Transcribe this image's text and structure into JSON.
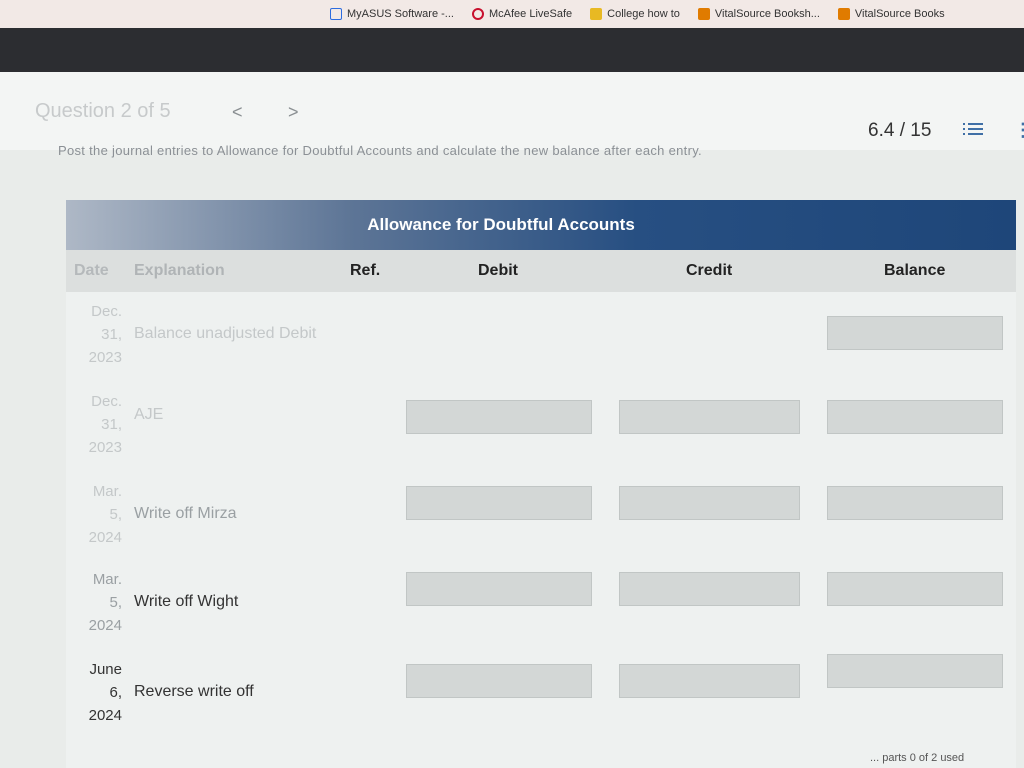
{
  "bookmarks": [
    {
      "label": "MyASUS Software -...",
      "color": "#2d6cdf"
    },
    {
      "label": "McAfee LiveSafe",
      "color": "#c8102e"
    },
    {
      "label": "College how to",
      "color": "#e8b923"
    },
    {
      "label": "VitalSource Booksh...",
      "color": "#e07b00"
    },
    {
      "label": "VitalSource Books",
      "color": "#e07b00"
    }
  ],
  "question": {
    "label": "Question 2 of 5",
    "prev": "<",
    "next": ">",
    "score": "6.4 / 15",
    "instruction": "Post the journal entries to Allowance for Doubtful Accounts and calculate the new balance after each entry."
  },
  "ledger": {
    "title": "Allowance for Doubtful Accounts",
    "columns": {
      "date": "Date",
      "explanation": "Explanation",
      "ref": "Ref.",
      "debit": "Debit",
      "credit": "Credit",
      "balance": "Balance"
    },
    "rows": [
      {
        "date_line1": "Dec.",
        "date_line2": "31,",
        "date_line3": "2023",
        "explanation": "Balance unadjusted Debit"
      },
      {
        "date_line1": "Dec.",
        "date_line2": "31,",
        "date_line3": "2023",
        "explanation": "AJE"
      },
      {
        "date_line1": "Mar.",
        "date_line2": "5,",
        "date_line3": "2024",
        "explanation": "Write off Mirza"
      },
      {
        "date_line1": "Mar.",
        "date_line2": "5,",
        "date_line3": "2024",
        "explanation": "Write off Wight"
      },
      {
        "date_line1": "June",
        "date_line2": "6,",
        "date_line3": "2024",
        "explanation": "Reverse write off"
      }
    ]
  },
  "footer": "... parts 0 of 2 used"
}
